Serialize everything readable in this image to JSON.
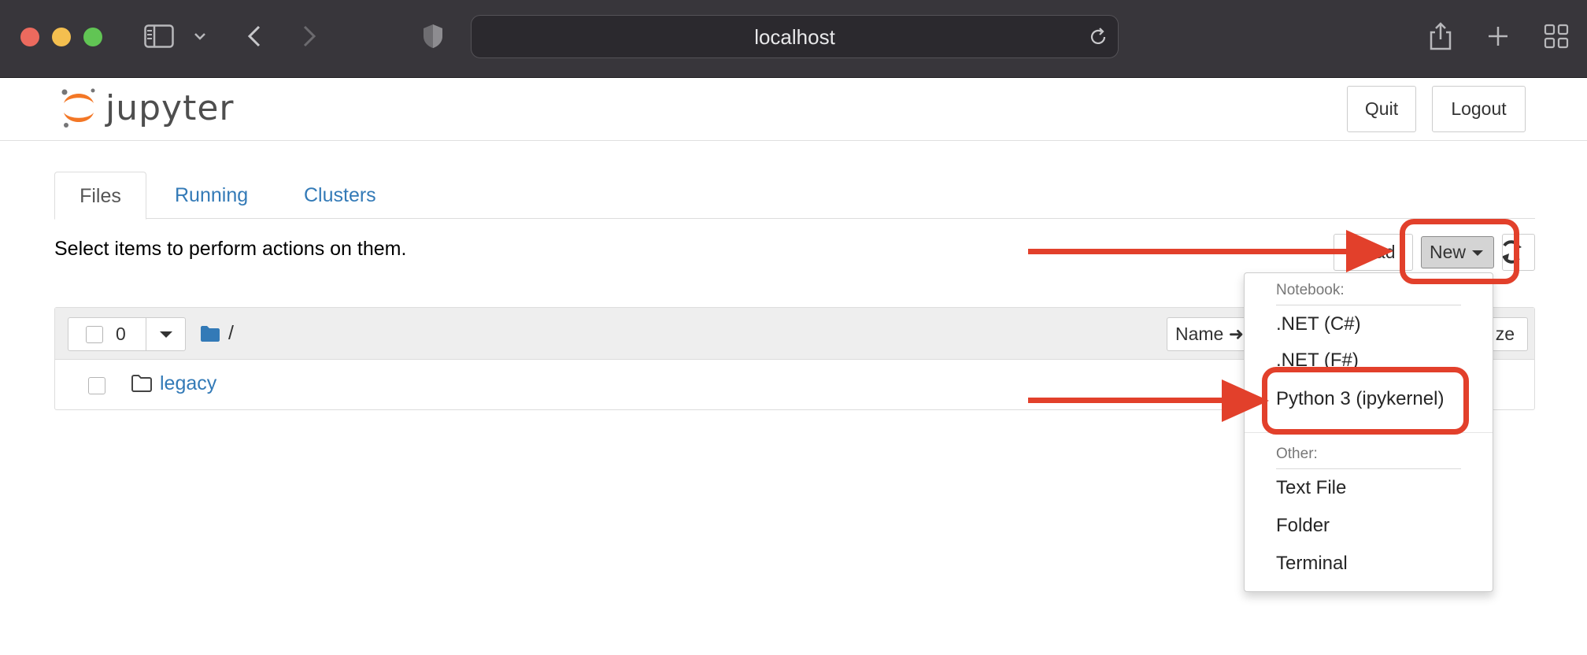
{
  "browser": {
    "url": "localhost",
    "icons": [
      "sidebar-icon",
      "chevron-down-icon",
      "back-icon",
      "forward-icon",
      "shield-icon",
      "reload-icon",
      "share-icon",
      "plus-icon",
      "tabs-grid-icon"
    ]
  },
  "header": {
    "logo_text": "jupyter",
    "quit_label": "Quit",
    "logout_label": "Logout"
  },
  "tabs": [
    {
      "label": "Files"
    },
    {
      "label": "Running"
    },
    {
      "label": "Clusters"
    }
  ],
  "toolbar": {
    "message": "Select items to perform actions on them.",
    "upload_label": "load",
    "new_label": "New"
  },
  "file_list": {
    "selected_count": "0",
    "path": "/",
    "name_sort_label": "Name ➜",
    "size_label": "ze",
    "rows": [
      {
        "name": "legacy"
      }
    ]
  },
  "new_menu": {
    "notebook_header": "Notebook:",
    "items": [
      ".NET (C#)",
      ".NET (F#)",
      "Python 3 (ipykernel)"
    ],
    "other_header": "Other:",
    "other_items": [
      "Text File",
      "Folder",
      "Terminal"
    ]
  },
  "colors": {
    "annotation": "#e2402b",
    "link": "#337ab7",
    "browser_bar": "#38363b"
  }
}
